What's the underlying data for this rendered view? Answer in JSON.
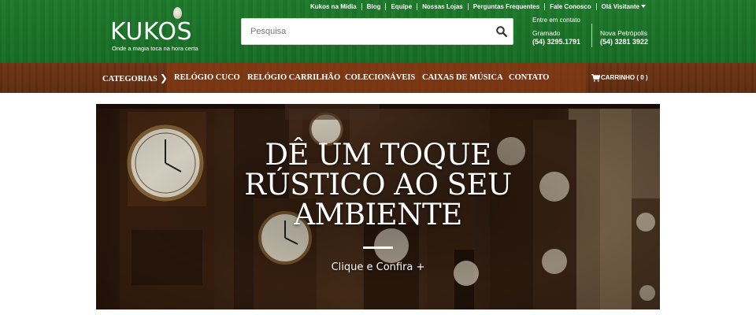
{
  "header": {
    "top_links": [
      {
        "label": "Kukos na Mídia"
      },
      {
        "label": "Blog"
      },
      {
        "label": "Equipe"
      },
      {
        "label": "Nossas Lojas"
      },
      {
        "label": "Perguntas Frequentes"
      },
      {
        "label": "Fale Conosco"
      },
      {
        "label": "Olá Visitante"
      }
    ],
    "logo": {
      "name": "KUKOS",
      "tagline": "Onde a magia toca na hora certa"
    },
    "search": {
      "placeholder": "Pesquisa",
      "icon": "search-icon"
    },
    "contact": {
      "title": "Entre em contato",
      "stores": [
        {
          "city": "Gramado",
          "phone": "(54) 3295.1791"
        },
        {
          "city": "Nova Petrópolis",
          "phone": "(54) 3281 3922"
        }
      ]
    },
    "colors": {
      "header_green": "#1f7a2c",
      "nav_brown": "#6d3313"
    }
  },
  "nav": {
    "categories": "CATEGORIAS",
    "items": [
      {
        "label": "RELÓGIO CUCO"
      },
      {
        "label": "RELÓGIO CARRILHÃO"
      },
      {
        "label": "COLECIONÁVEIS"
      },
      {
        "label": "CAIXAS DE MÚSICA"
      },
      {
        "label": "CONTATO"
      }
    ],
    "cart": {
      "label": "CARRINHO ( 0 )",
      "icon": "cart-icon"
    }
  },
  "hero": {
    "title": "DÊ UM TOQUE RÚSTICO AO SEU AMBIENTE",
    "cta": "Clique e Confira +"
  }
}
